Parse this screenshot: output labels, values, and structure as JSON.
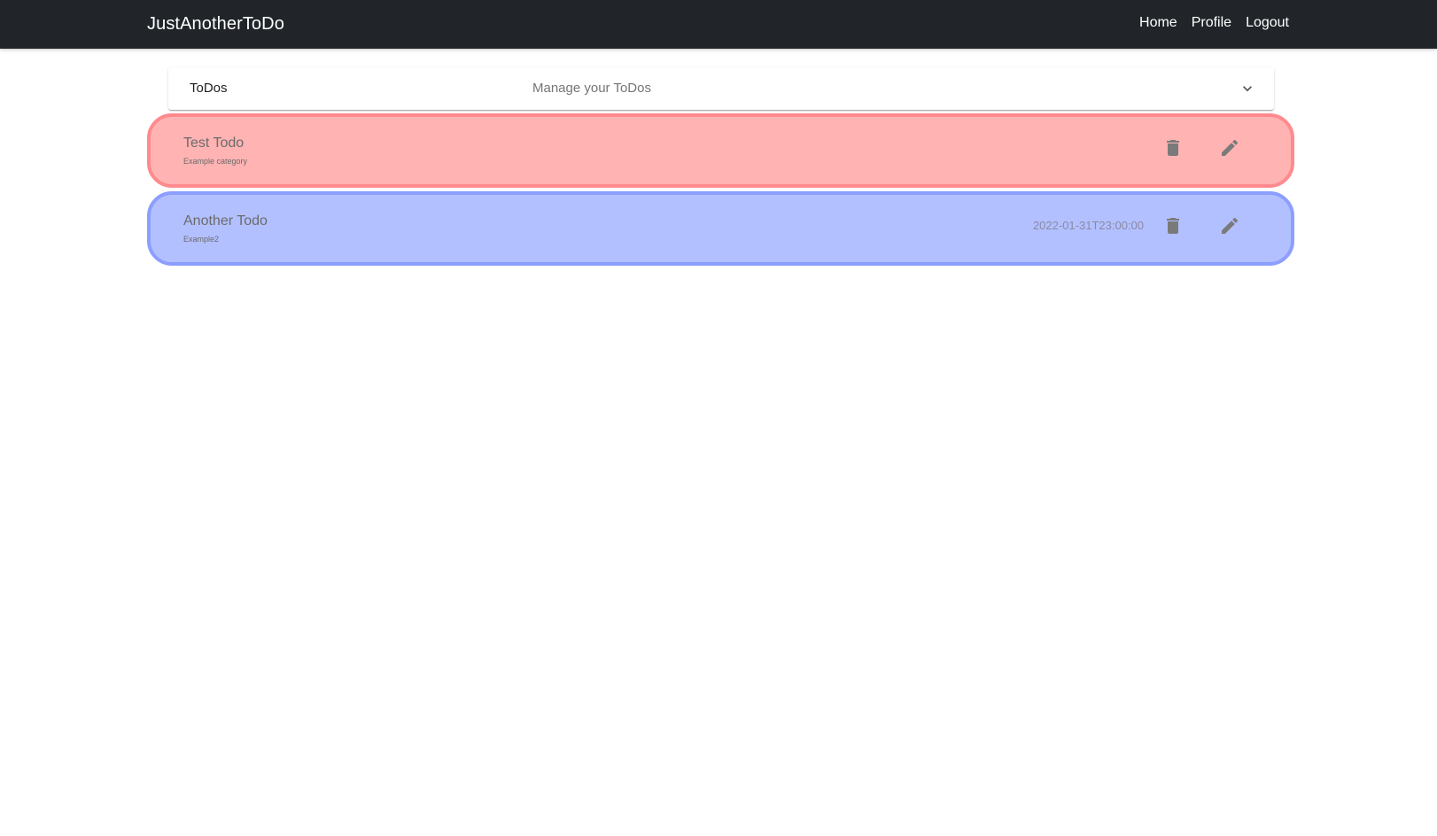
{
  "navbar": {
    "brand": "JustAnotherToDo",
    "links": [
      {
        "label": "Home"
      },
      {
        "label": "Profile"
      },
      {
        "label": "Logout"
      }
    ]
  },
  "panel": {
    "title": "ToDos",
    "description": "Manage your ToDos",
    "icon": "chevron-down-icon"
  },
  "todos": [
    {
      "title": "Test Todo",
      "category": "Example category",
      "date": "",
      "background": "#ffb3b3",
      "border": "#ff8a8e",
      "icons": [
        "trash-icon",
        "pencil-icon"
      ]
    },
    {
      "title": "Another Todo",
      "category": "Example2",
      "date": "2022-01-31T23:00:00",
      "background": "#b3c0ff",
      "border": "#8c9eff",
      "icons": [
        "trash-icon",
        "pencil-icon"
      ]
    }
  ],
  "colors": {
    "navbar_bg": "#212529",
    "icon": "#7a7a7a"
  }
}
